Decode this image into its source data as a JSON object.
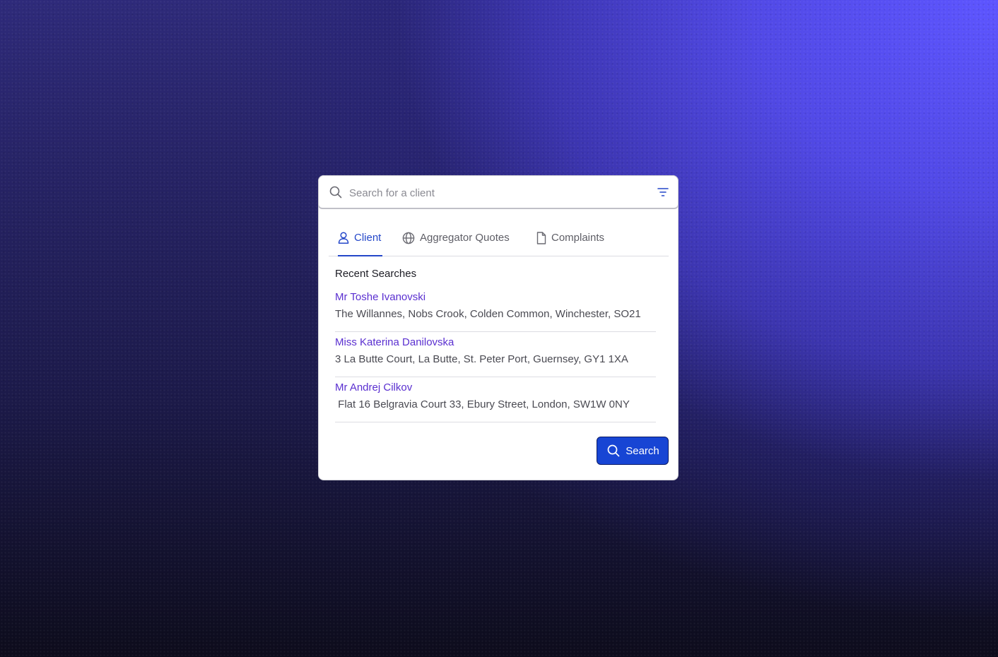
{
  "search": {
    "placeholder": "Search for a client"
  },
  "icons": {
    "search": "search-icon",
    "filter": "filter-icon",
    "client_tab": "user-icon",
    "aggregator_tab": "globe-icon",
    "complaints_tab": "document-icon"
  },
  "tabs": [
    {
      "label": "Client",
      "active": true
    },
    {
      "label": "Aggregator Quotes",
      "active": false
    },
    {
      "label": "Complaints",
      "active": false
    }
  ],
  "recent": {
    "title": "Recent Searches",
    "items": [
      {
        "name": "Mr Toshe Ivanovski",
        "address": "The Willannes, Nobs Crook, Colden Common, Winchester, SO21"
      },
      {
        "name": "Miss Katerina Danilovska",
        "address": "3 La Butte Court, La Butte, St. Peter Port, Guernsey, GY1 1XA"
      },
      {
        "name": "Mr Andrej Cilkov",
        "address": " Flat 16 Belgravia Court 33, Ebury Street, London, SW1W 0NY"
      }
    ]
  },
  "actions": {
    "search_label": "Search"
  },
  "colors": {
    "accent": "#2447c9",
    "link": "#5a2fd0",
    "button": "#1745d4",
    "button_border": "#0a1a66",
    "background_top_right": "#5d55ff",
    "background_bottom_left": "#0e0d1f"
  }
}
